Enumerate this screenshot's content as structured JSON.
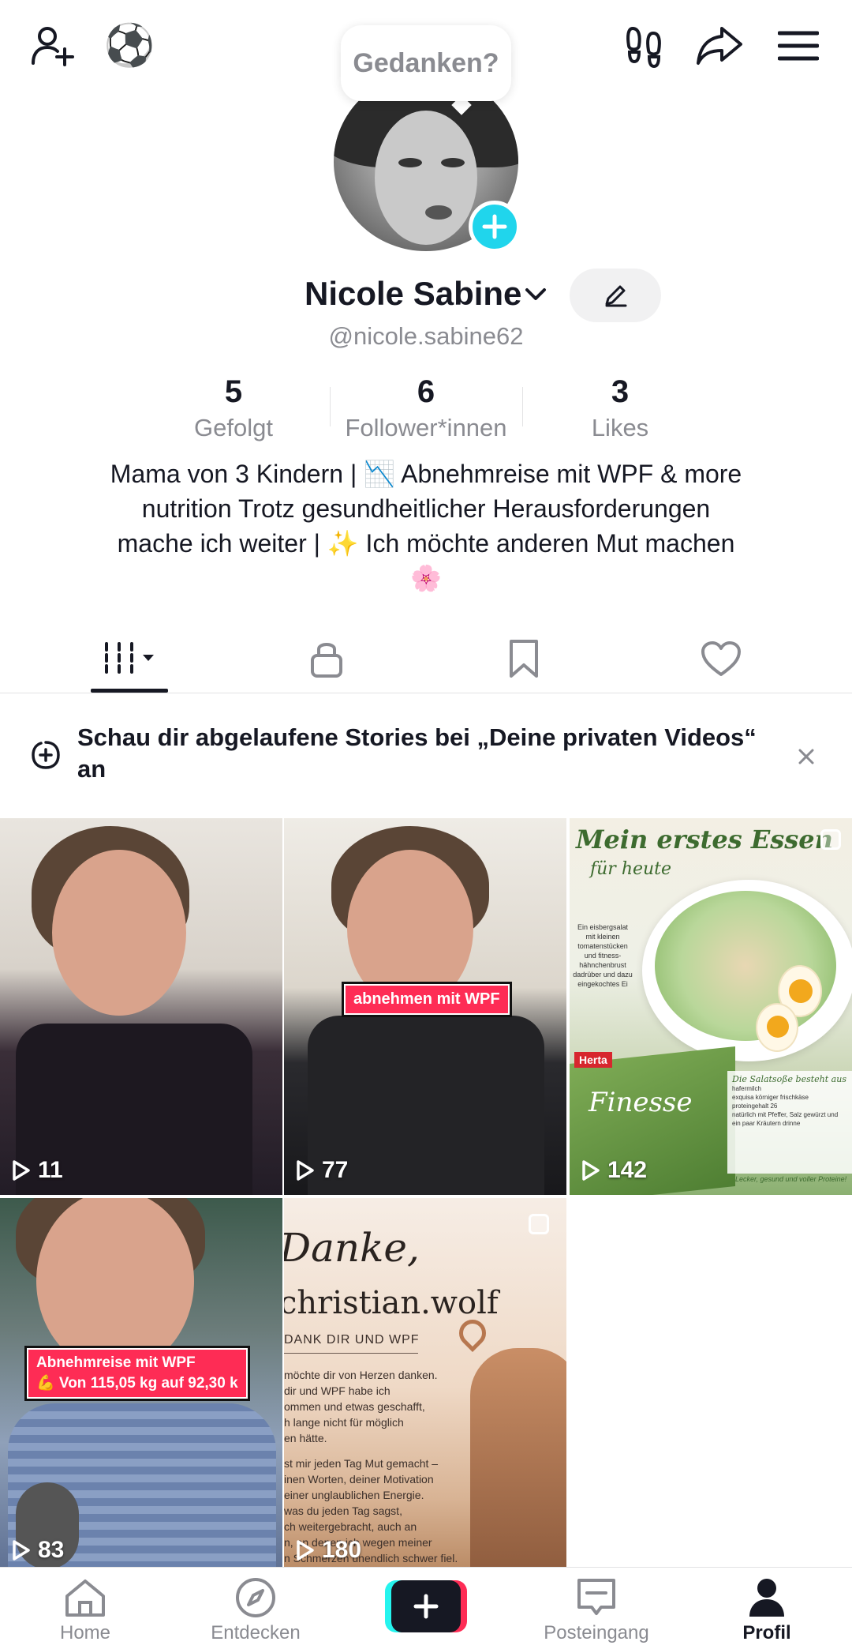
{
  "topbar": {
    "add_friend_icon": "add-person-icon",
    "sport_emoji": "⚽",
    "footsteps_icon": "footprints-icon",
    "share_icon": "share-arrow-icon",
    "menu_icon": "hamburger-menu-icon"
  },
  "profile": {
    "thought_bubble": "Gedanken?",
    "display_name": "Nicole Sabine",
    "handle": "@nicole.sabine62",
    "bio_line1": "Mama von 3 Kindern | 📉 Abnehmreise mit WPF & more",
    "bio_line2": "nutrition Trotz gesundheitlicher Herausforderungen",
    "bio_line3": "mache ich weiter | ✨ Ich möchte anderen Mut machen",
    "bio_line4": "🌸"
  },
  "stats": [
    {
      "value": "5",
      "label": "Gefolgt"
    },
    {
      "value": "6",
      "label": "Follower*innen"
    },
    {
      "value": "3",
      "label": "Likes"
    }
  ],
  "tabs": [
    {
      "icon": "videos-grid-icon",
      "active": true
    },
    {
      "icon": "lock-icon",
      "active": false
    },
    {
      "icon": "bookmark-icon",
      "active": false
    },
    {
      "icon": "heart-icon",
      "active": false
    }
  ],
  "banner": {
    "text": "Schau dir abgelaufene Stories bei „Deine privaten Videos“ an"
  },
  "videos": [
    {
      "views": "11"
    },
    {
      "views": "77",
      "caption": "abnehmen mit WPF"
    },
    {
      "views": "142",
      "title": "Mein erstes Essen",
      "subtitle": "für heute",
      "side_text": "Ein eisbergsalat mit kleinen tomatenstücken und fitness-hähnchenbrust dadrüber und dazu eingekochtes Ei",
      "brand": "Herta",
      "product": "Finesse",
      "note_title": "Die Salatsoße besteht aus",
      "note_items": [
        "hafermilch",
        "exquisa körniger frischkäse",
        "proteingehalt 26",
        "natürlich mit Pfeffer, Salz gewürzt und ein paar Kräutern drinne"
      ],
      "footer": "Lecker, gesund und voller Proteine!"
    },
    {
      "views": "83",
      "caption_line1": "Abnehmreise mit WPF",
      "caption_line2": "💪 Von 115,05 kg auf 92,30 k"
    },
    {
      "views": "180",
      "title": "Danke,",
      "name": "christian.wolf",
      "sub": "DANK DIR UND WPF",
      "text_lines": [
        "möchte dir von Herzen danken.",
        "dir und WPF habe ich",
        "ommen und etwas geschafft,",
        "h lange nicht für möglich",
        "en hätte.",
        "",
        "st mir jeden Tag Mut gemacht –",
        "inen Worten, deiner Motivation",
        "einer unglaublichen Energie.",
        "was du jeden Tag sagst,",
        "ch weitergebracht, auch an",
        "n, an denen ich wegen meiner",
        "n Schmerzen unendlich schwer fiel."
      ]
    }
  ],
  "bottom_nav": [
    {
      "label": "Home",
      "icon": "home-icon"
    },
    {
      "label": "Entdecken",
      "icon": "compass-icon"
    },
    {
      "label": "",
      "icon": "plus-icon"
    },
    {
      "label": "Posteingang",
      "icon": "inbox-icon"
    },
    {
      "label": "Profil",
      "icon": "profile-icon",
      "active": true
    }
  ],
  "colors": {
    "accent_cyan": "#20d5ec",
    "accent_red": "#fe2c55",
    "text_primary": "#161823",
    "text_secondary": "#8a8b91"
  }
}
